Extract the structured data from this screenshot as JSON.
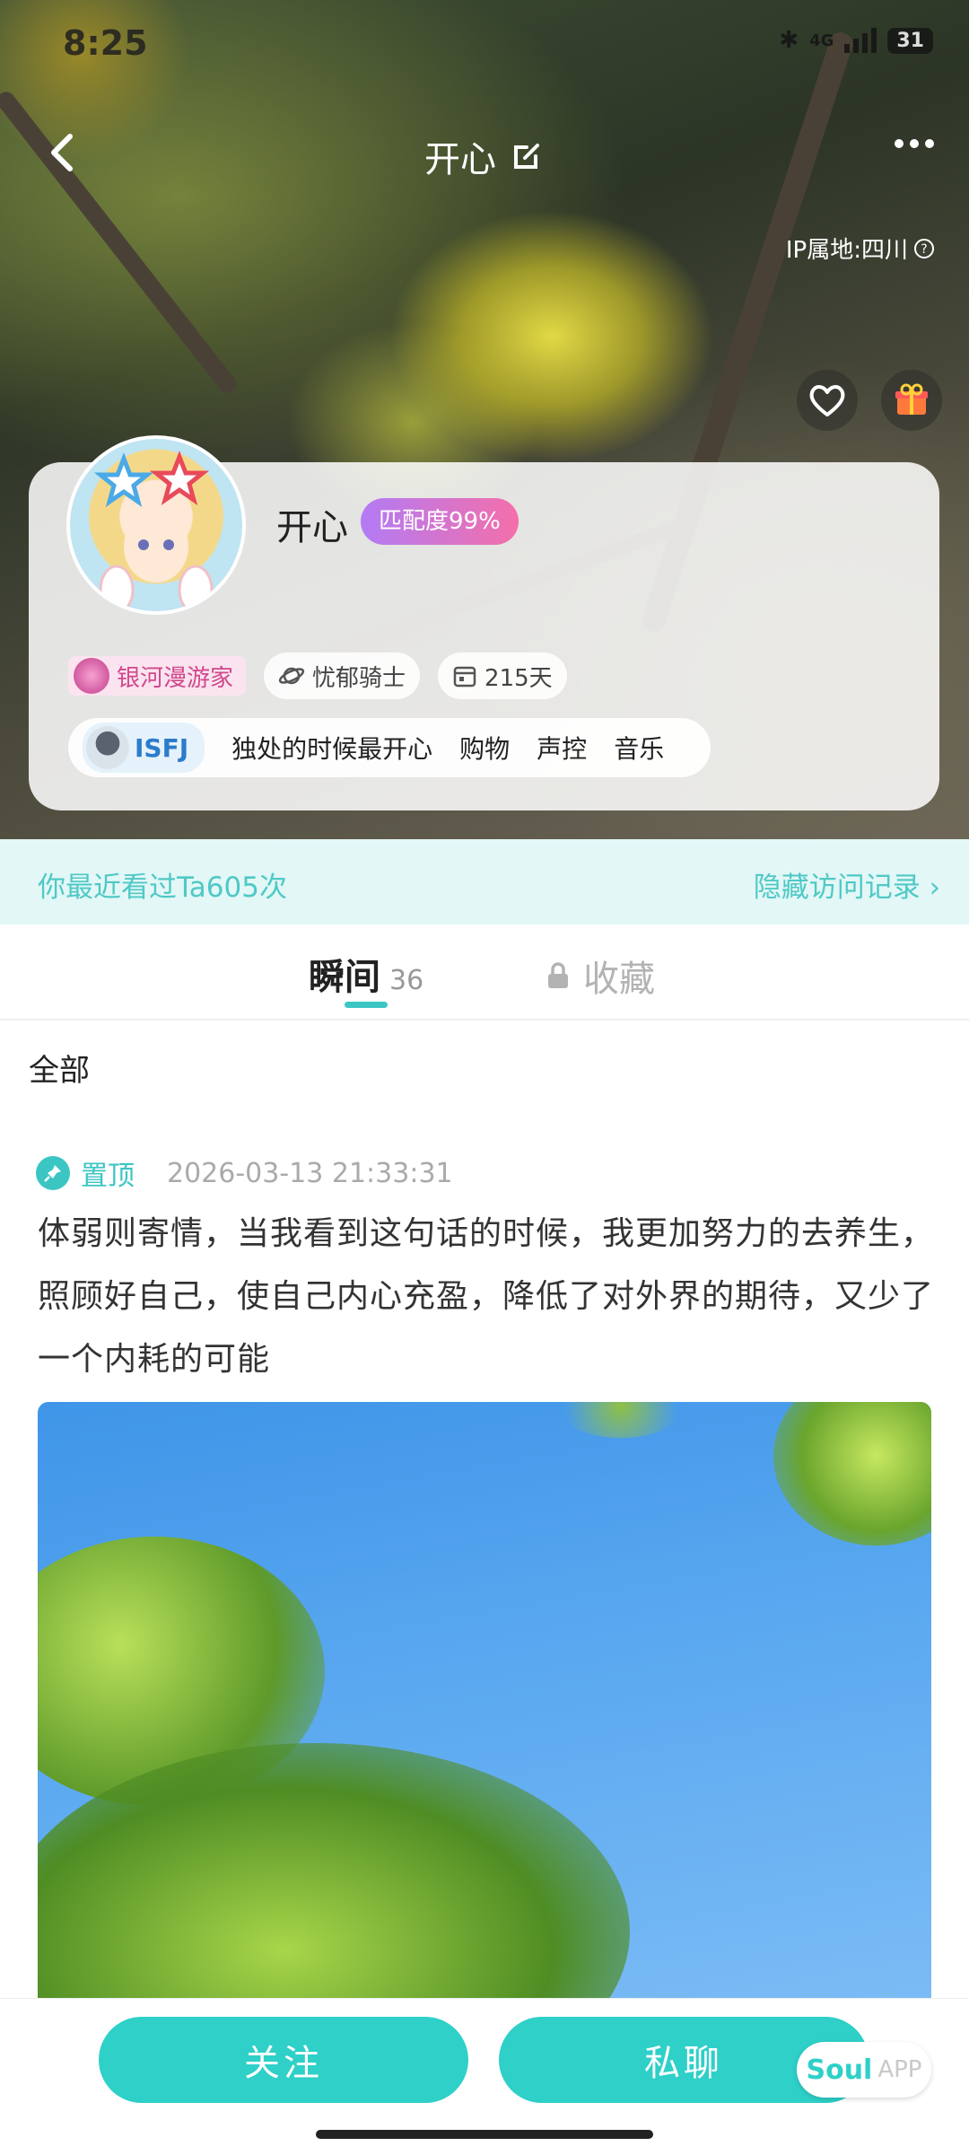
{
  "status_bar": {
    "time": "8:25",
    "network": "4G",
    "battery": "31"
  },
  "header": {
    "title": "开心",
    "ip_location": "IP属地:四川"
  },
  "profile": {
    "nickname": "开心",
    "match": "匹配度99%",
    "badges": {
      "galaxy": "银河漫游家",
      "planet": "忧郁骑士",
      "days": "215天"
    },
    "tags": {
      "mbti": "ISFJ",
      "items": [
        "独处的时候最开心",
        "购物",
        "声控",
        "音乐"
      ]
    }
  },
  "visit_bar": {
    "left": "你最近看过Ta605次",
    "right": "隐藏访问记录 ›"
  },
  "tabs": {
    "moments_label": "瞬间",
    "moments_count": "36",
    "favorites_label": "收藏"
  },
  "filter": {
    "label": "全部"
  },
  "post": {
    "pin_label": "置顶",
    "time": "2026-03-13 21:33:31",
    "text": "体弱则寄情，当我看到这句话的时候，我更加努力的去养生，照顾好自己，使自己内心充盈，降低了对外界的期待，又少了一个内耗的可能"
  },
  "actions": {
    "follow": "关注",
    "chat": "私聊"
  },
  "brand": {
    "name": "Soul",
    "suffix": "APP"
  },
  "colors": {
    "accent": "#2ed0c8",
    "match_gradient_start": "#b27bf5",
    "match_gradient_end": "#f46fa9",
    "visit_bar_bg": "#e2f7f6"
  }
}
